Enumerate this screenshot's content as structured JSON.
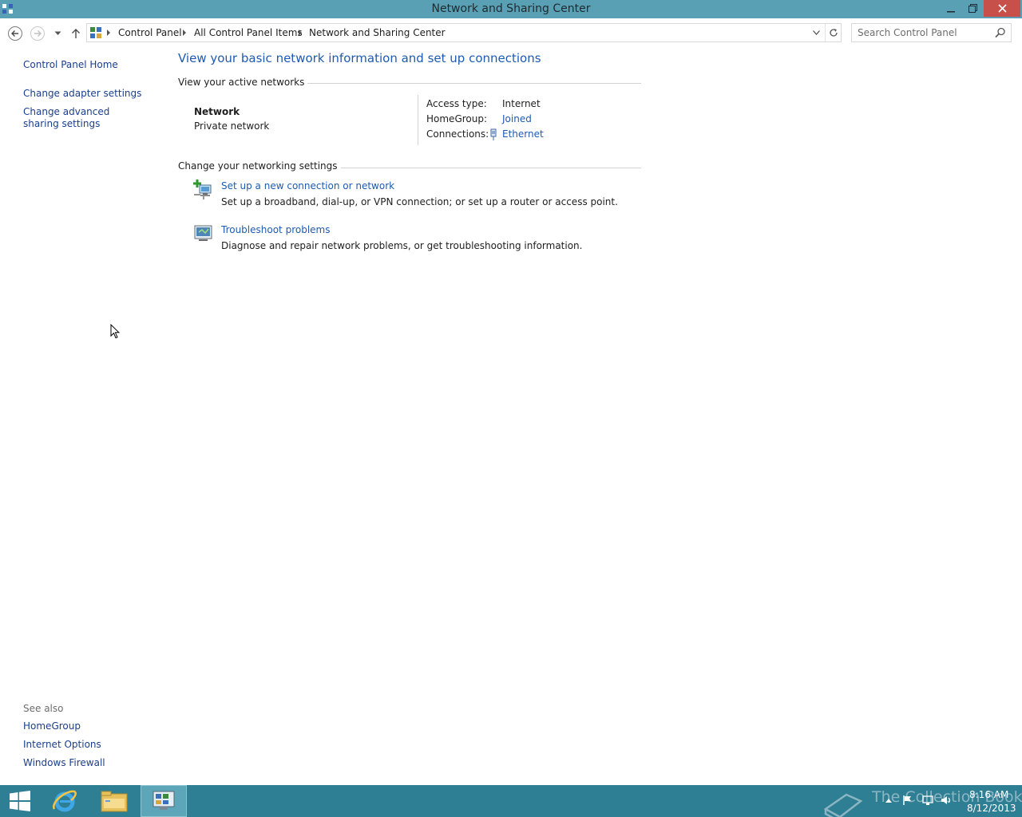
{
  "window": {
    "title": "Network and Sharing Center"
  },
  "navigation": {
    "breadcrumbs": [
      "Control Panel",
      "All Control Panel Items",
      "Network and Sharing Center"
    ],
    "search_placeholder": "Search Control Panel"
  },
  "left_pane": {
    "home_link": "Control Panel Home",
    "links": [
      "Change adapter settings",
      "Change advanced sharing settings"
    ],
    "see_also_title": "See also",
    "see_also_links": [
      "HomeGroup",
      "Internet Options",
      "Windows Firewall"
    ]
  },
  "main": {
    "title": "View your basic network information and set up connections",
    "active_networks_heading": "View your active networks",
    "network": {
      "name": "Network",
      "category": "Private network",
      "access_type_label": "Access type:",
      "access_type_value": "Internet",
      "homegroup_label": "HomeGroup:",
      "homegroup_value": "Joined",
      "connections_label": "Connections:",
      "connections_value": "Ethernet"
    },
    "change_settings_heading": "Change your networking settings",
    "tasks": [
      {
        "icon": "new-connection-icon",
        "link": "Set up a new connection or network",
        "description": "Set up a broadband, dial-up, or VPN connection; or set up a router or access point."
      },
      {
        "icon": "troubleshoot-icon",
        "link": "Troubleshoot problems",
        "description": "Diagnose and repair network problems, or get troubleshooting information."
      }
    ]
  },
  "taskbar": {
    "watermark": "The Collection Book",
    "time": "8:16 AM",
    "date": "8/12/2013"
  },
  "colors": {
    "titlebar": "#5aa0b5",
    "taskbar": "#2f7f94",
    "link": "#1e5bb0",
    "close_button": "#c7504a"
  }
}
